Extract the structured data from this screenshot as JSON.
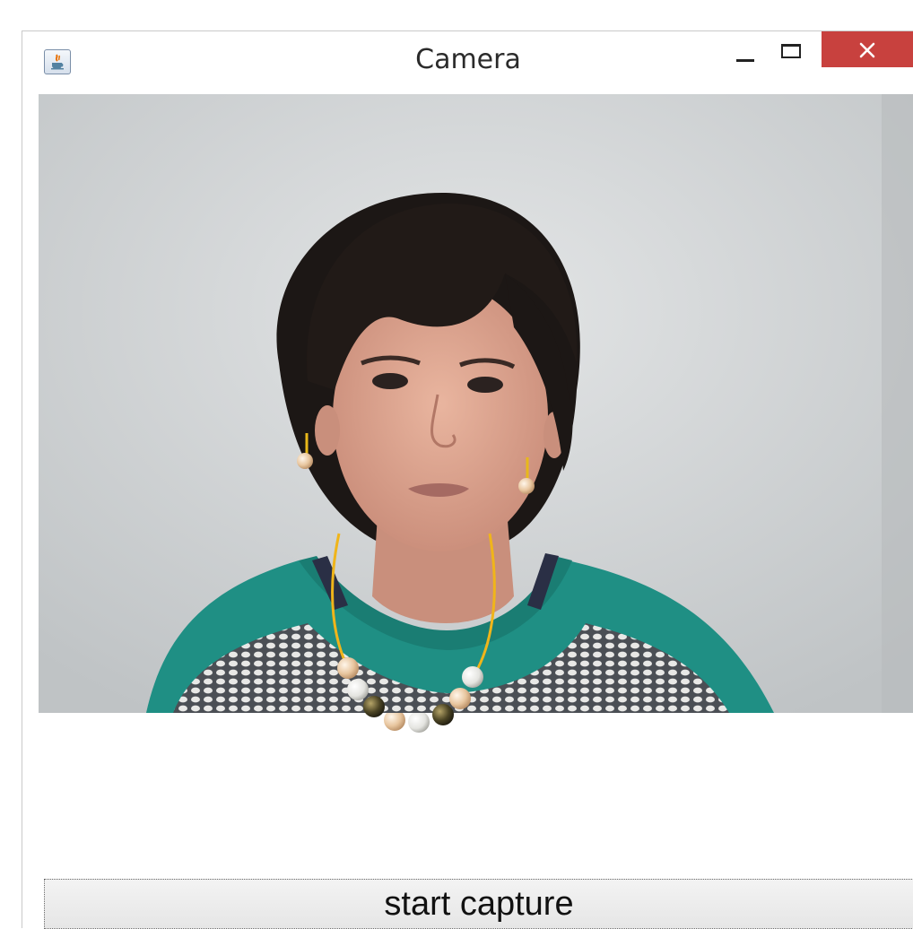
{
  "window": {
    "title": "Camera",
    "icon": "java-icon"
  },
  "controls": {
    "minimize": "minimize-icon",
    "maximize": "maximize-icon",
    "close": "close-icon",
    "close_color": "#c8413e"
  },
  "camera": {
    "overlays": [
      "necklace",
      "left-earring",
      "right-earring"
    ]
  },
  "actions": {
    "capture_label": "start capture"
  }
}
